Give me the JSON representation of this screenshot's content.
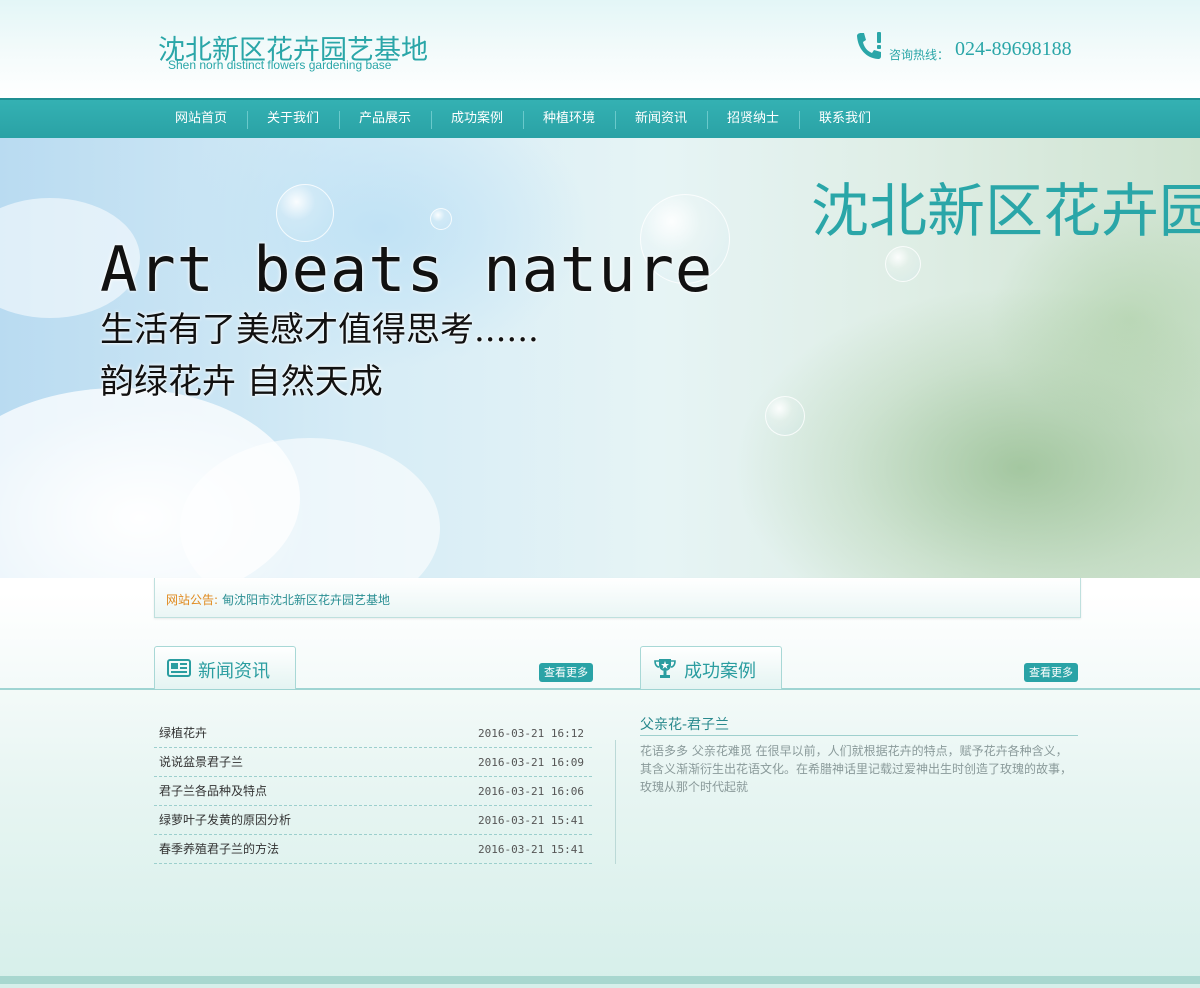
{
  "header": {
    "logo_cn": "沈北新区花卉园艺基地",
    "logo_en": "Shen norh distinct flowers gardening base",
    "hotline_label": "咨询热线：",
    "hotline_number": "024-89698188"
  },
  "nav": {
    "items": [
      {
        "label": "网站首页"
      },
      {
        "label": "关于我们"
      },
      {
        "label": "产品展示"
      },
      {
        "label": "成功案例"
      },
      {
        "label": "种植环境"
      },
      {
        "label": "新闻资讯"
      },
      {
        "label": "招贤纳士"
      },
      {
        "label": "联系我们"
      }
    ]
  },
  "banner": {
    "title_cn": "沈北新区花卉园艺",
    "tagline_en": "Art beats nature",
    "line1": "生活有了美感才值得思考......",
    "line2": "韵绿花卉 自然天成"
  },
  "notice": {
    "label": "网站公告:",
    "text": "甸沈阳市沈北新区花卉园艺基地"
  },
  "news": {
    "title": "新闻资讯",
    "more": "查看更多",
    "items": [
      {
        "title": "绿植花卉",
        "date": "2016-03-21 16:12"
      },
      {
        "title": "说说盆景君子兰",
        "date": "2016-03-21 16:09"
      },
      {
        "title": "君子兰各品种及特点",
        "date": "2016-03-21 16:06"
      },
      {
        "title": "绿萝叶子发黄的原因分析",
        "date": "2016-03-21 15:41"
      },
      {
        "title": "春季养殖君子兰的方法",
        "date": "2016-03-21 15:41"
      }
    ]
  },
  "cases": {
    "title": "成功案例",
    "more": "查看更多",
    "item_title": "父亲花-君子兰",
    "item_desc": "花语多多  父亲花难觅  在很早以前，人们就根据花卉的特点，赋予花卉各种含义，其含义渐渐衍生出花语文化。在希腊神话里记载过爱神出生时创造了玫瑰的故事，玫瑰从那个时代起就"
  },
  "colors": {
    "brand": "#2aa6a8",
    "nav_bg": "#2aa2a5",
    "notice_label": "#e08a1e"
  }
}
